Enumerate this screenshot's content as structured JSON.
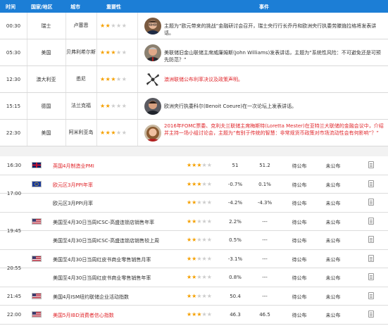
{
  "header": {
    "time": "时间",
    "country": "国家/地区",
    "city": "城市",
    "importance": "重要性",
    "event": "事件"
  },
  "speeches": [
    {
      "time": "00:30",
      "country": "瑞士",
      "city": "卢塞恩",
      "stars": 2,
      "avatar": "man-glasses",
      "text": "主题为“欧元带来的挑战”金融研讨会召开，瑞士央行行长乔丹和欧洲央行执委劳滕施拉格将发表讲话。",
      "red": false
    },
    {
      "time": "05:30",
      "country": "美国",
      "city": "贝弗利希尔斯",
      "stars": 3,
      "avatar": "man-gray",
      "text": "美联储旧金山联储主席威廉姆斯(John Williams)发表讲话，主题为“系统性风险：不可避免还是可预先防范？”",
      "red": false
    },
    {
      "time": "12:30",
      "country": "澳大利亚",
      "city": "悉尼",
      "stars": 3,
      "avatar": "rba-logo",
      "text": "澳洲联储公布利率决议及政策声明。",
      "red": true
    },
    {
      "time": "15:15",
      "country": "德国",
      "city": "法兰克福",
      "stars": 2,
      "avatar": "man-dark",
      "text": "欧洲央行执委科尔(Benoit Coeure)在一次论坛上发表讲话。",
      "red": false
    },
    {
      "time": "22:30",
      "country": "美国",
      "city": "阿米利亚岛",
      "stars": 3,
      "avatar": "woman",
      "text": "2016年FOMC票委、克利夫兰联储主席梅斯特(Loretta Mester)在亚特兰大联储的金融会议中，介绍并主持一场小组讨论会，主题为“有别于传统的智慧：非常规货币政策对市场流动性会有何影响”？”",
      "red": true
    }
  ],
  "data_rows": [
    {
      "time": "16:30",
      "flag": "uk",
      "name": "英国4月制造业PMI",
      "red": true,
      "stars": 3,
      "previous": "51",
      "forecast": "51.2",
      "actual": "待公布",
      "impact": "未公布"
    },
    {
      "time": "17:00",
      "flag": "eu",
      "name": "欧元区3月PPI年率",
      "red": true,
      "stars": 3,
      "previous": "-0.7%",
      "forecast": "0.1%",
      "actual": "待公布",
      "impact": "未公布"
    },
    {
      "time": "",
      "flag": "",
      "name": "欧元区3月PPI月率",
      "red": false,
      "stars": 2,
      "previous": "-4.2%",
      "forecast": "-4.3%",
      "actual": "待公布",
      "impact": "未公布"
    },
    {
      "time": "19:45",
      "flag": "us",
      "name": "美国至4月30日当周ICSC-高盛连锁店销售年率",
      "red": false,
      "stars": 2,
      "previous": "2.2%",
      "forecast": "---",
      "actual": "待公布",
      "impact": "未公布"
    },
    {
      "time": "",
      "flag": "",
      "name": "美国至4月30日当周ICSC-高盛连锁店销售较上周",
      "red": false,
      "stars": 2,
      "previous": "0.5%",
      "forecast": "---",
      "actual": "待公布",
      "impact": "未公布"
    },
    {
      "time": "20:55",
      "flag": "us",
      "name": "美国至4月30日当周红皮书商业零售销售月率",
      "red": false,
      "stars": 2,
      "previous": "-3.1%",
      "forecast": "---",
      "actual": "待公布",
      "impact": "未公布"
    },
    {
      "time": "",
      "flag": "",
      "name": "美国至4月30日当周红皮书商业零售销售年率",
      "red": false,
      "stars": 2,
      "previous": "0.8%",
      "forecast": "---",
      "actual": "待公布",
      "impact": "未公布"
    },
    {
      "time": "21:45",
      "flag": "us",
      "name": "美国4月ISM纽约联储企业活动指数",
      "red": false,
      "stars": 2,
      "previous": "50.4",
      "forecast": "---",
      "actual": "待公布",
      "impact": "未公布"
    },
    {
      "time": "22:00",
      "flag": "us",
      "name": "美国5月IBD消费者信心指数",
      "red": true,
      "stars": 3,
      "previous": "46.3",
      "forecast": "46.5",
      "actual": "待公布",
      "impact": "未公布"
    }
  ],
  "colors": {
    "header_bg": "#1c7ed6",
    "accent_red": "#e0262b",
    "star_on": "#f5a000",
    "star_off": "#cccccc"
  }
}
